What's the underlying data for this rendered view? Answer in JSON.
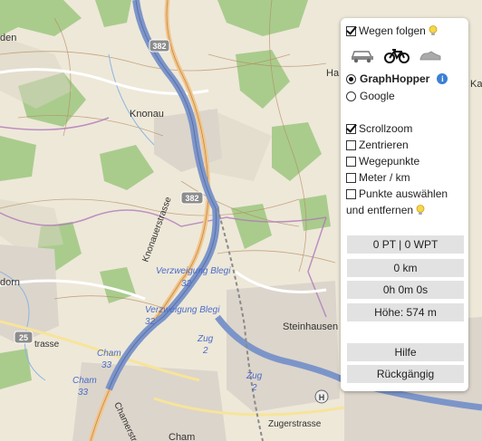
{
  "map": {
    "place_labels": {
      "knonau": "Knonau",
      "steinhausen": "Steinhausen",
      "cham": "Cham",
      "den": "den",
      "dorn": "dorn",
      "ha": "Ha",
      "ka": "Ka"
    },
    "road_labels": {
      "knonauerstrasse": "Knonauerstrasse",
      "verzweigung1": "Verzweigung Blegi",
      "verzweigung1_num": "32",
      "verzweigung2": "Verzweigung Blegi",
      "verzweigung2_num": "32",
      "zug1": "Zug",
      "zug1_num": "2",
      "zug2": "Zug",
      "zug2_num": "2",
      "cham1": "Cham",
      "cham1_num": "33",
      "cham2": "Cham",
      "cham2_num": "33",
      "trasse": "trasse",
      "zugerstrasse": "Zugerstrasse",
      "chamstrasse": "Chamerstrasse"
    },
    "shields": {
      "a382_top": "382",
      "a382_mid": "382",
      "r25": "25",
      "h": "H"
    }
  },
  "panel": {
    "follow_roads": {
      "label": "Wegen folgen",
      "checked": true
    },
    "vehicles": {
      "car": "car-icon",
      "bike": "bike-icon",
      "foot": "shoe-icon",
      "selected": "bike"
    },
    "routers": [
      {
        "label": "GraphHopper",
        "checked": true
      },
      {
        "label": "Google",
        "checked": false
      }
    ],
    "options": [
      {
        "label": "Scrollzoom",
        "checked": true
      },
      {
        "label": "Zentrieren",
        "checked": false
      },
      {
        "label": "Wegepunkte",
        "checked": false
      },
      {
        "label": "Meter / km",
        "checked": false
      },
      {
        "label": "Punkte auswählen",
        "checked": false
      }
    ],
    "options_continuation": "und entfernen",
    "stats": {
      "points": "0 PT | 0 WPT",
      "distance": "0 km",
      "time": "0h 0m 0s",
      "height": "Höhe: 574 m"
    },
    "help_button": "Hilfe",
    "undo_button": "Rückgängig"
  }
}
